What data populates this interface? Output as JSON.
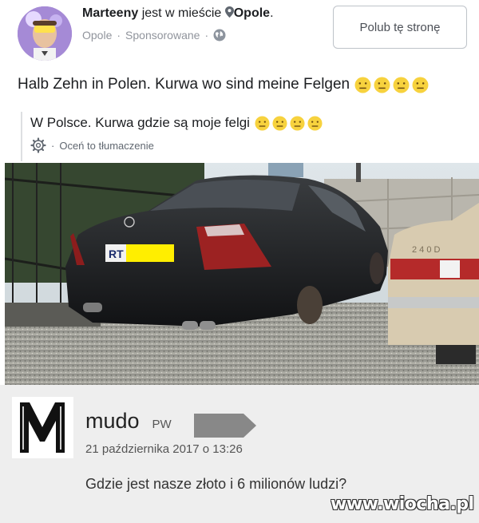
{
  "post": {
    "author": "Marteeny",
    "checkin_prefix": "jest w mieście",
    "location": "Opole",
    "location_suffix": ".",
    "meta_place": "Opole",
    "meta_sponsored": "Sponsorowane",
    "like_button": "Polub tę stronę",
    "text": "Halb Zehn in Polen. Kurwa wo sind meine Felgen",
    "emoji_count": 4,
    "translation_text": "W Polsce. Kurwa gdzie są moje felgi",
    "translation_link": "Oceń to tłumaczenie",
    "plate_text": "RT"
  },
  "comment": {
    "logo_letter": "M",
    "username": "mudo",
    "flag": "PW",
    "date": "21 października 2017 o 13:26",
    "text": "Gdzie jest nasze złoto i 6 milionów ludzi?"
  },
  "watermark": "www.wiocha.pl",
  "colors": {
    "emoji": "#f7d23e",
    "plate_sticker": "#ffee00",
    "comment_bg": "#eeeeee"
  }
}
